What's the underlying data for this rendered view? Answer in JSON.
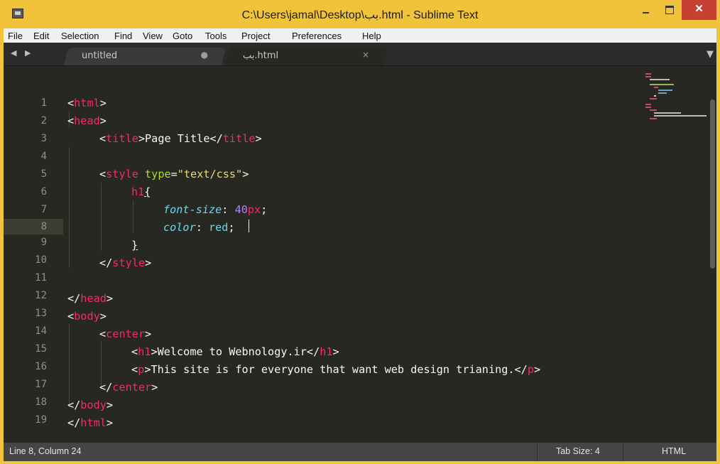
{
  "window": {
    "title": "C:\\Users\\jamal\\Desktop\\بب.html - Sublime Text",
    "close_glyph": "✕",
    "accent": "#f0c33a"
  },
  "menu": [
    "File",
    "Edit",
    "Selection",
    "Find",
    "View",
    "Goto",
    "Tools",
    "Project",
    "Preferences",
    "Help"
  ],
  "tabs": [
    {
      "label": "untitled",
      "status": "●",
      "state": "modified"
    },
    {
      "label": "بب.html",
      "status": "×",
      "state": "active"
    }
  ],
  "tab_nav": "◀ ▶",
  "tab_dropdown": "▼",
  "editor": {
    "line_numbers": [
      "1",
      "2",
      "3",
      "4",
      "5",
      "6",
      "7",
      "8",
      "9",
      "10",
      "11",
      "12",
      "13",
      "14",
      "15",
      "16",
      "17",
      "18",
      "19"
    ],
    "lines": {
      "l1": {
        "lt": "<",
        "tag": "html",
        "gt": ">"
      },
      "l2": {
        "lt": "<",
        "tag": "head",
        "gt": ">"
      },
      "l3": {
        "lt": "<",
        "tag": "title",
        "gt": ">",
        "text": "Page Title",
        "close_lt": "</",
        "close_tag": "title",
        "close_gt": ">"
      },
      "l5": {
        "lt": "<",
        "tag": "style",
        "sp": " ",
        "attr": "type",
        "eq": "=",
        "val": "\"text/css\"",
        "gt": ">"
      },
      "l6": {
        "sel": "h1",
        "brace": "{"
      },
      "l7": {
        "prop": "font-size",
        "colon": ": ",
        "num": "40",
        "unit": "px",
        "semi": ";"
      },
      "l8": {
        "prop": "color",
        "colon": ": ",
        "val": "red",
        "semi": ";"
      },
      "l9": {
        "brace": "}"
      },
      "l10": {
        "lt": "</",
        "tag": "style",
        "gt": ">"
      },
      "l12": {
        "lt": "</",
        "tag": "head",
        "gt": ">"
      },
      "l13": {
        "lt": "<",
        "tag": "body",
        "gt": ">"
      },
      "l14": {
        "lt": "<",
        "tag": "center",
        "gt": ">"
      },
      "l15": {
        "lt": "<",
        "tag": "h1",
        "gt": ">",
        "text": "Welcome to Webnology.ir",
        "close_lt": "</",
        "close_tag": "h1",
        "close_gt": ">"
      },
      "l16": {
        "lt": "<",
        "tag": "p",
        "gt": ">",
        "text": "This site is for everyone that want web design trianing.",
        "close_lt": "</",
        "close_tag": "p",
        "close_gt": ">"
      },
      "l17": {
        "lt": "</",
        "tag": "center",
        "gt": ">"
      },
      "l18": {
        "lt": "</",
        "tag": "body",
        "gt": ">"
      },
      "l19": {
        "lt": "</",
        "tag": "html",
        "gt": ">"
      }
    },
    "highlighted_line": 8
  },
  "statusbar": {
    "position": "Line 8, Column 24",
    "tab_size": "Tab Size: 4",
    "syntax": "HTML"
  }
}
